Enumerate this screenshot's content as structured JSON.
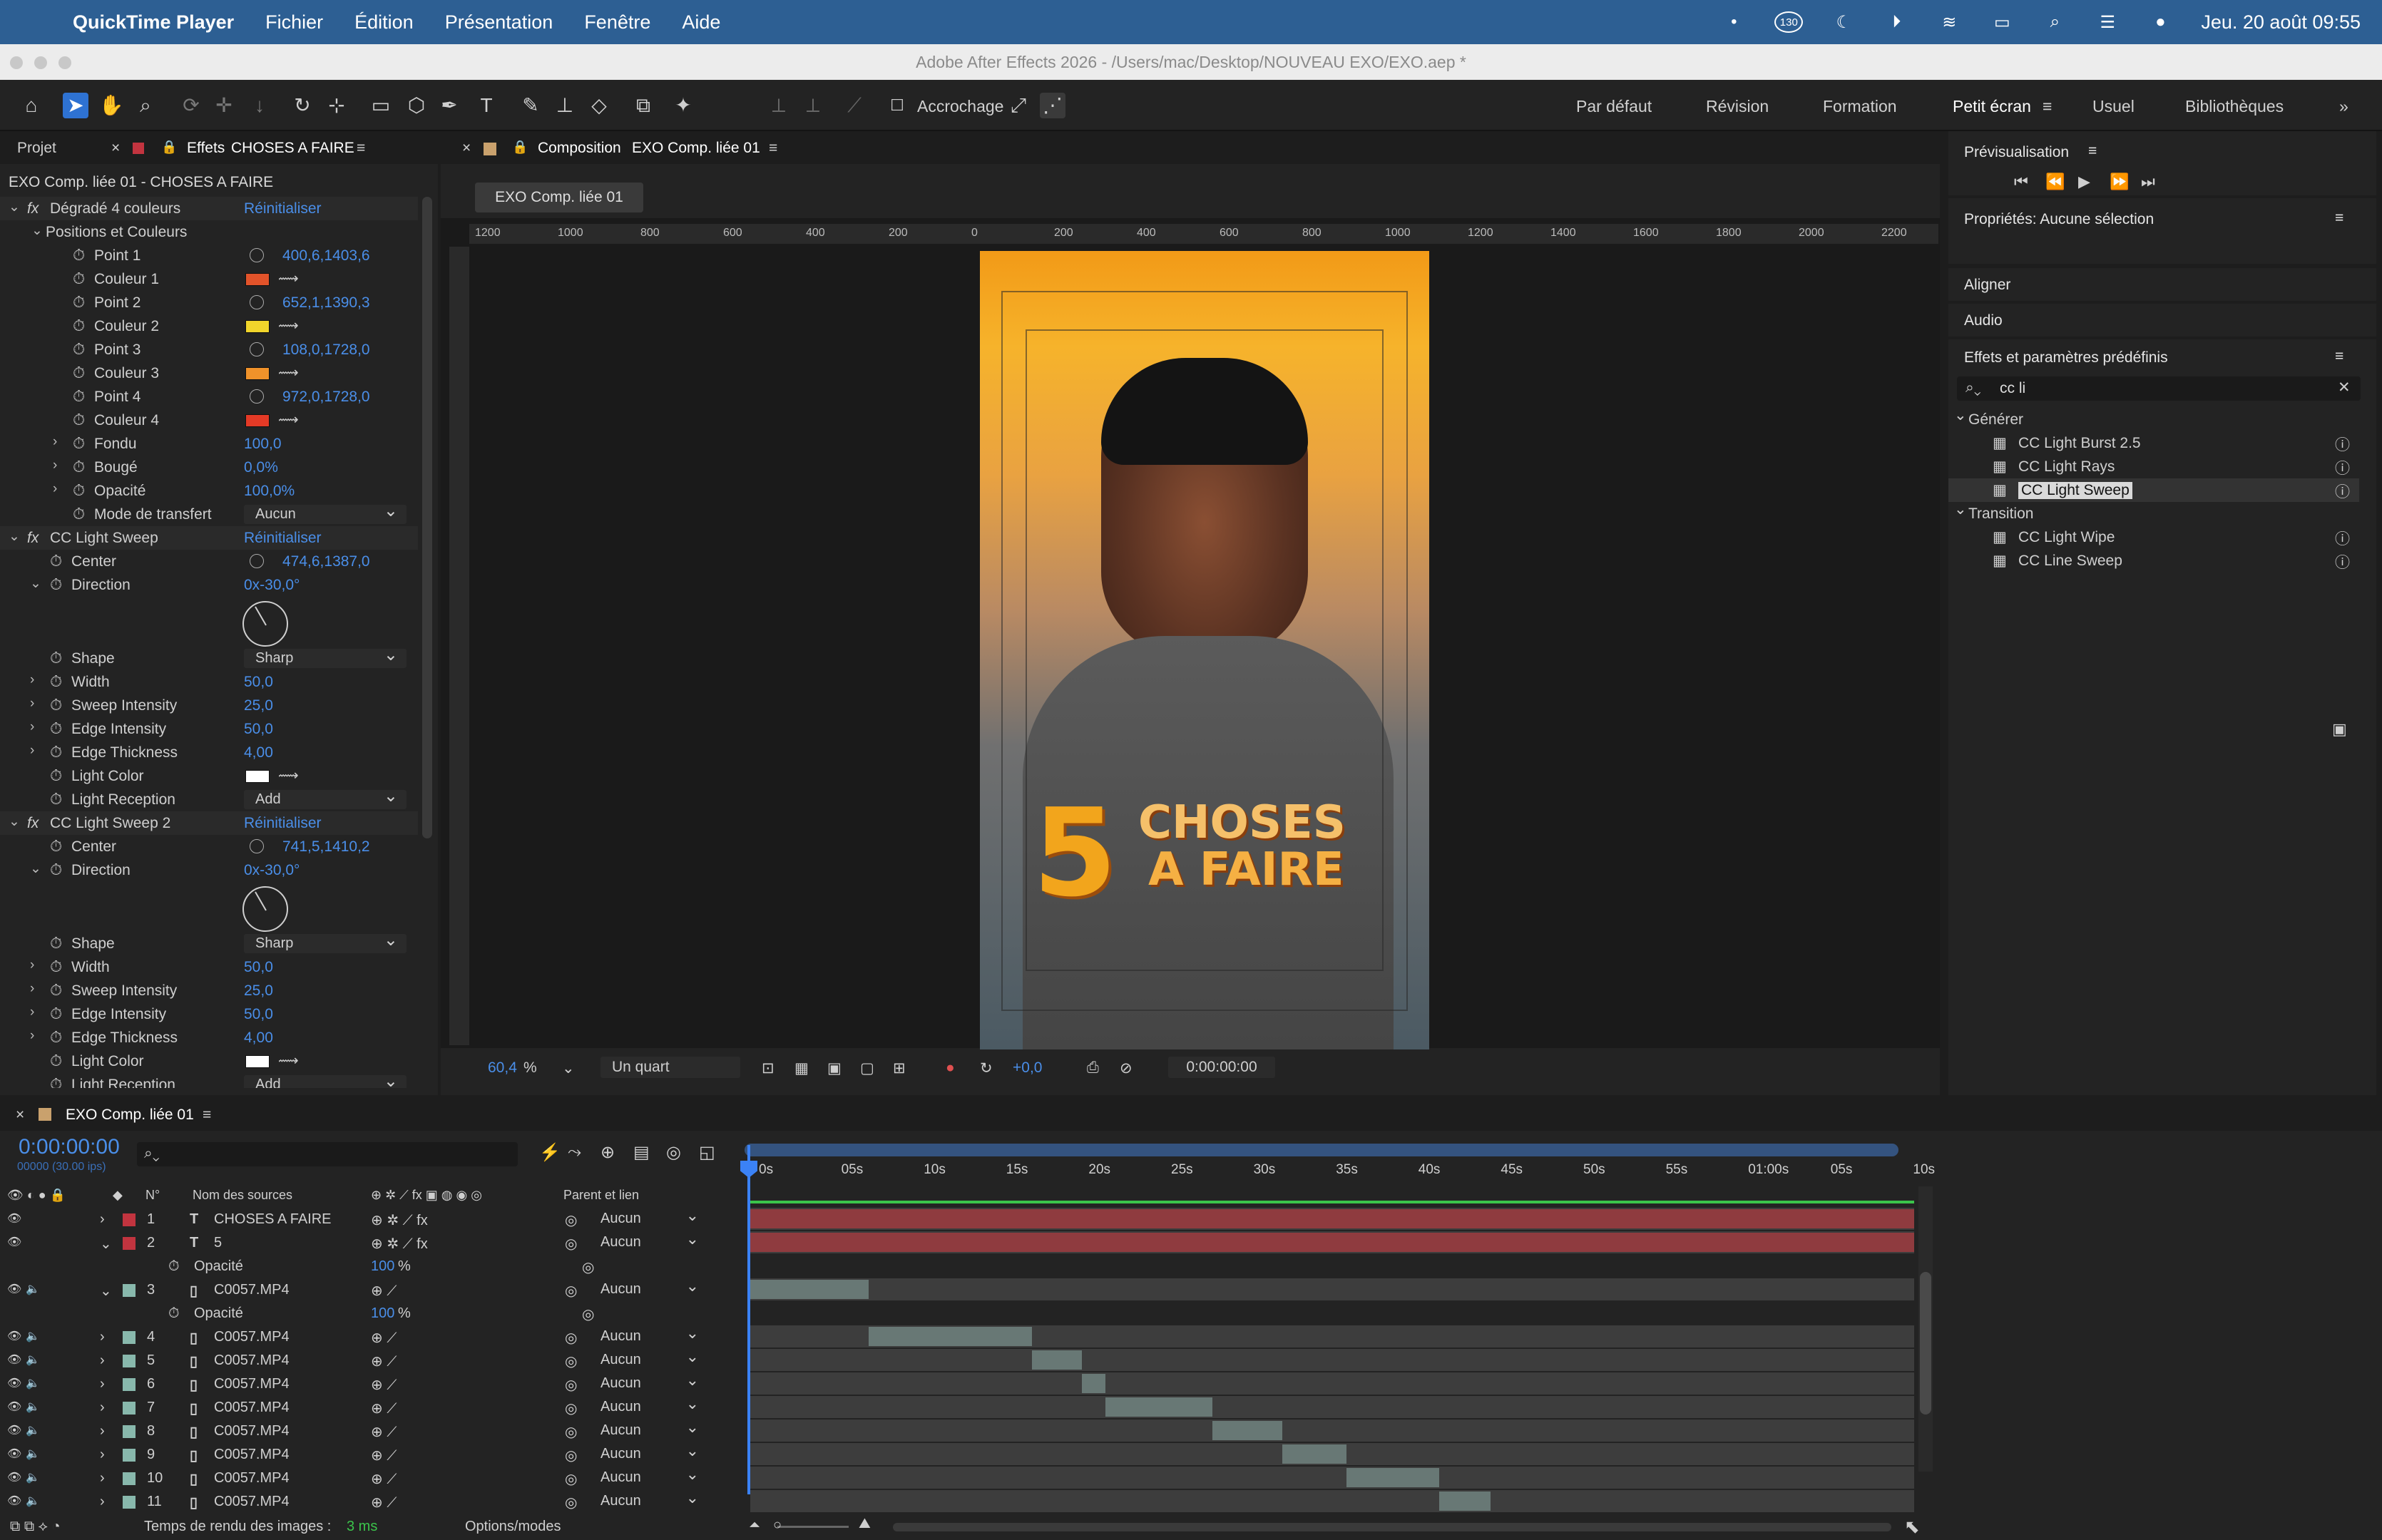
{
  "menubar": {
    "app": "QuickTime Player",
    "items": [
      "Fichier",
      "Édition",
      "Présentation",
      "Fenêtre",
      "Aide"
    ],
    "clock": "Jeu. 20 août 09:55",
    "badge": "130"
  },
  "window_title": "Adobe After Effects 2026 - /Users/mac/Desktop/NOUVEAU EXO/EXO.aep *",
  "toolbar": {
    "snapping_label": "Accrochage",
    "workspaces": [
      "Par défaut",
      "Révision",
      "Formation",
      "Petit écran",
      "Usuel",
      "Bibliothèques"
    ],
    "active_workspace": "Petit écran"
  },
  "fx_panel": {
    "tab_project": "Projet",
    "tab_effects": "Effets",
    "tab_effects_target": "CHOSES A FAIRE",
    "subtitle": "EXO Comp. liée 01 - CHOSES A FAIRE",
    "reset_label": "Réinitialiser",
    "rows": [
      {
        "kind": "fx",
        "label": "Dégradé 4 couleurs",
        "value": "Réinitialiser"
      },
      {
        "kind": "group",
        "label": "Positions et Couleurs"
      },
      {
        "kind": "point",
        "label": "Point 1",
        "value": "400,6,1403,6"
      },
      {
        "kind": "color",
        "label": "Couleur 1",
        "color": "#e2532a"
      },
      {
        "kind": "point",
        "label": "Point 2",
        "value": "652,1,1390,3"
      },
      {
        "kind": "color",
        "label": "Couleur 2",
        "color": "#f1d52b"
      },
      {
        "kind": "point",
        "label": "Point 3",
        "value": "108,0,1728,0"
      },
      {
        "kind": "color",
        "label": "Couleur 3",
        "color": "#f0922a"
      },
      {
        "kind": "point",
        "label": "Point 4",
        "value": "972,0,1728,0"
      },
      {
        "kind": "color",
        "label": "Couleur 4",
        "color": "#e43a26"
      },
      {
        "kind": "prop",
        "label": "Fondu",
        "value": "100,0"
      },
      {
        "kind": "prop",
        "label": "Bougé",
        "value": "0,0%"
      },
      {
        "kind": "prop",
        "label": "Opacité",
        "value": "100,0%"
      },
      {
        "kind": "dropdown",
        "label": "Mode de transfert",
        "value": "Aucun"
      },
      {
        "kind": "fx",
        "label": "CC Light Sweep",
        "value": "Réinitialiser"
      },
      {
        "kind": "point",
        "label": "Center",
        "value": "474,6,1387,0"
      },
      {
        "kind": "angle",
        "label": "Direction",
        "value": "0x-30,0°"
      },
      {
        "kind": "dial"
      },
      {
        "kind": "dropdown",
        "label": "Shape",
        "value": "Sharp"
      },
      {
        "kind": "prop",
        "label": "Width",
        "value": "50,0"
      },
      {
        "kind": "prop",
        "label": "Sweep Intensity",
        "value": "25,0"
      },
      {
        "kind": "prop",
        "label": "Edge Intensity",
        "value": "50,0"
      },
      {
        "kind": "prop",
        "label": "Edge Thickness",
        "value": "4,00"
      },
      {
        "kind": "color",
        "label": "Light Color",
        "color": "#ffffff"
      },
      {
        "kind": "dropdown",
        "label": "Light Reception",
        "value": "Add"
      },
      {
        "kind": "fx",
        "label": "CC Light Sweep 2",
        "value": "Réinitialiser"
      },
      {
        "kind": "point",
        "label": "Center",
        "value": "741,5,1410,2"
      },
      {
        "kind": "angle",
        "label": "Direction",
        "value": "0x-30,0°"
      },
      {
        "kind": "dial"
      },
      {
        "kind": "dropdown",
        "label": "Shape",
        "value": "Sharp"
      },
      {
        "kind": "prop",
        "label": "Width",
        "value": "50,0"
      },
      {
        "kind": "prop",
        "label": "Sweep Intensity",
        "value": "25,0"
      },
      {
        "kind": "prop",
        "label": "Edge Intensity",
        "value": "50,0"
      },
      {
        "kind": "prop",
        "label": "Edge Thickness",
        "value": "4,00"
      },
      {
        "kind": "color",
        "label": "Light Color",
        "color": "#ffffff"
      },
      {
        "kind": "dropdown",
        "label": "Light Reception",
        "value": "Add"
      }
    ]
  },
  "comp": {
    "tab_label": "Composition",
    "comp_name": "EXO Comp. liée 01",
    "flow_chip": "EXO Comp. liée 01",
    "ruler_ticks": [
      "1200",
      "1000",
      "800",
      "600",
      "400",
      "200",
      "0",
      "200",
      "400",
      "600",
      "800",
      "1000",
      "1200",
      "1400",
      "1600",
      "1800",
      "2000",
      "2200"
    ],
    "frame_text_number": "5",
    "frame_text_line1": "CHOSES",
    "frame_text_line2": "A FAIRE",
    "zoom": "60,4",
    "zoom_unit": "%",
    "resolution": "Un quart",
    "exposure": "+0,0",
    "timecode": "0:00:00:00"
  },
  "right": {
    "preview_title": "Prévisualisation",
    "properties_title": "Propriétés: Aucune sélection",
    "align_title": "Aligner",
    "audio_title": "Audio",
    "effects_title": "Effets et paramètres prédéfinis",
    "search_value": "cc li",
    "tree": [
      {
        "kind": "folder",
        "label": "Générer"
      },
      {
        "kind": "item",
        "label": "CC Light Burst 2.5"
      },
      {
        "kind": "item",
        "label": "CC Light Rays"
      },
      {
        "kind": "item",
        "label": "CC Light Sweep",
        "selected": true
      },
      {
        "kind": "folder",
        "label": "Transition"
      },
      {
        "kind": "item",
        "label": "CC Light Wipe"
      },
      {
        "kind": "item",
        "label": "CC Line Sweep"
      }
    ]
  },
  "timeline": {
    "tab_label": "EXO Comp. liée 01",
    "timecode": "0:00:00:00",
    "frames_info": "00000 (30.00 ips)",
    "search_placeholder": "",
    "col_num": "N°",
    "col_source": "Nom des sources",
    "col_parent": "Parent et lien",
    "time_labels": [
      "0s",
      "05s",
      "10s",
      "15s",
      "20s",
      "25s",
      "30s",
      "35s",
      "40s",
      "45s",
      "50s",
      "55s",
      "01:00s",
      "05s",
      "10s"
    ],
    "layers": [
      {
        "num": "1",
        "type": "T",
        "name": "CHOSES A FAIRE",
        "parent": "Aucun",
        "label_color": "#c2343f",
        "expanded": false,
        "bar_start": 0.0,
        "bar_end": 1.0,
        "bar_color": "#8f3b3f"
      },
      {
        "num": "2",
        "type": "T",
        "name": "5",
        "parent": "Aucun",
        "label_color": "#c2343f",
        "expanded": true,
        "bar_start": 0.0,
        "bar_end": 1.0,
        "bar_color": "#8f3b3f",
        "sub": {
          "label": "Opacité",
          "value": "100",
          "unit": "%"
        }
      },
      {
        "num": "3",
        "type": "F",
        "name": "C0057.MP4",
        "parent": "Aucun",
        "label_color": "#88b8ac",
        "expanded": true,
        "bar_start": 0.0,
        "bar_end": 0.102,
        "bar_color": "#687875",
        "sub": {
          "label": "Opacité",
          "value": "100",
          "unit": "%"
        }
      },
      {
        "num": "4",
        "type": "F",
        "name": "C0057.MP4",
        "parent": "Aucun",
        "label_color": "#88b8ac",
        "expanded": false,
        "bar_start": 0.102,
        "bar_end": 0.242,
        "bar_color": "#687875"
      },
      {
        "num": "5",
        "type": "F",
        "name": "C0057.MP4",
        "parent": "Aucun",
        "label_color": "#88b8ac",
        "expanded": false,
        "bar_start": 0.242,
        "bar_end": 0.285,
        "bar_color": "#687875"
      },
      {
        "num": "6",
        "type": "F",
        "name": "C0057.MP4",
        "parent": "Aucun",
        "label_color": "#88b8ac",
        "expanded": false,
        "bar_start": 0.285,
        "bar_end": 0.305,
        "bar_color": "#687875"
      },
      {
        "num": "7",
        "type": "F",
        "name": "C0057.MP4",
        "parent": "Aucun",
        "label_color": "#88b8ac",
        "expanded": false,
        "bar_start": 0.305,
        "bar_end": 0.397,
        "bar_color": "#687875"
      },
      {
        "num": "8",
        "type": "F",
        "name": "C0057.MP4",
        "parent": "Aucun",
        "label_color": "#88b8ac",
        "expanded": false,
        "bar_start": 0.397,
        "bar_end": 0.457,
        "bar_color": "#687875"
      },
      {
        "num": "9",
        "type": "F",
        "name": "C0057.MP4",
        "parent": "Aucun",
        "label_color": "#88b8ac",
        "expanded": false,
        "bar_start": 0.457,
        "bar_end": 0.512,
        "bar_color": "#687875"
      },
      {
        "num": "10",
        "type": "F",
        "name": "C0057.MP4",
        "parent": "Aucun",
        "label_color": "#88b8ac",
        "expanded": false,
        "bar_start": 0.512,
        "bar_end": 0.592,
        "bar_color": "#687875"
      },
      {
        "num": "11",
        "type": "F",
        "name": "C0057.MP4",
        "parent": "Aucun",
        "label_color": "#88b8ac",
        "expanded": false,
        "bar_start": 0.592,
        "bar_end": 0.636,
        "bar_color": "#687875"
      }
    ],
    "render_label": "Temps de rendu des images :",
    "render_value": "3 ms",
    "options_label": "Options/modes"
  }
}
